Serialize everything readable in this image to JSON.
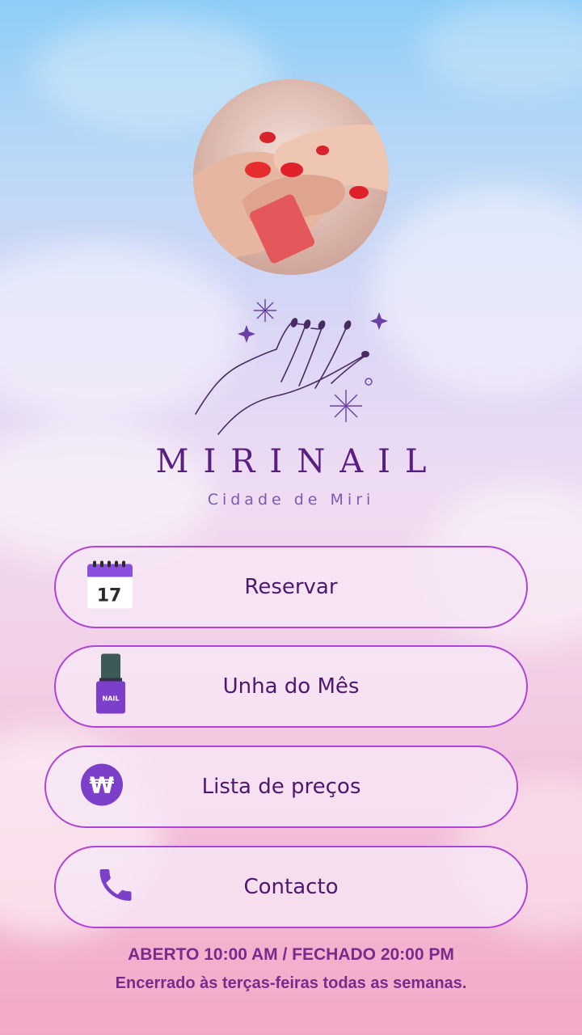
{
  "brand": {
    "name": "MIRINAIL",
    "subtitle": "Cidade de Miri"
  },
  "buttons": [
    {
      "label": "Reservar",
      "icon": "calendar-icon",
      "icon_text": "17"
    },
    {
      "label": "Unha do Mês",
      "icon": "nail-polish-icon",
      "icon_text": "NAIL"
    },
    {
      "label": "Lista de preços",
      "icon": "won-coin-icon",
      "icon_text": "₩"
    },
    {
      "label": "Contacto",
      "icon": "phone-icon"
    }
  ],
  "hours": {
    "open_close": "ABERTO 10:00 AM / FECHADO 20:00 PM",
    "closed_note": "Encerrado às terças-feiras todas as semanas."
  },
  "colors": {
    "accent": "#b044d6",
    "brand_text": "#5a1d82",
    "button_text": "#4e1770",
    "icon_purple": "#7c3fc9"
  }
}
